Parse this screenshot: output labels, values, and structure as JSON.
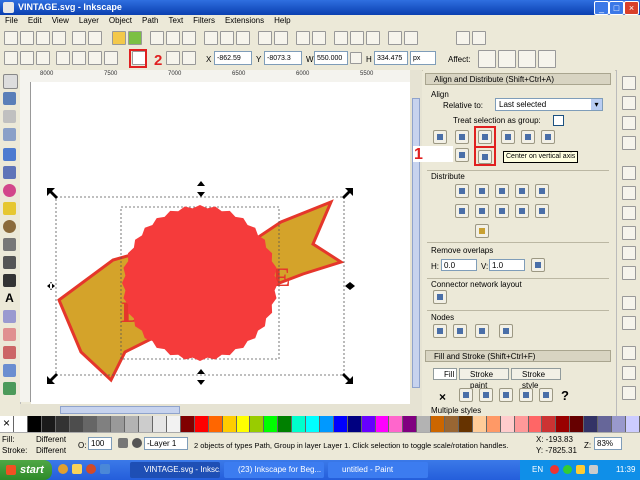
{
  "window": {
    "title": "VINTAGE.svg - Inkscape"
  },
  "menu": [
    "File",
    "Edit",
    "View",
    "Layer",
    "Object",
    "Path",
    "Text",
    "Filters",
    "Extensions",
    "Help"
  ],
  "controls": {
    "x_label": "X",
    "x_value": "-862.59",
    "y_label": "Y",
    "y_value": "-8073.3",
    "w_label": "W",
    "w_value": "550.000",
    "h_label": "H",
    "h_value": "334.475",
    "unit": "px",
    "affect_label": "Affect:"
  },
  "ruler": {
    "h_ticks": [
      "8000",
      "7500",
      "7000",
      "6500",
      "6000",
      "5500"
    ]
  },
  "annotations": {
    "one": "1",
    "two": "2"
  },
  "dock": {
    "align_title": "Align and Distribute (Shift+Ctrl+A)",
    "align_label": "Align",
    "relative_to_label": "Relative to:",
    "relative_to_value": "Last selected",
    "treat_group_label": "Treat selection as group:",
    "tooltip": "Center on vertical axis",
    "distribute_label": "Distribute",
    "remove_overlaps_label": "Remove overlaps",
    "h_label": "H:",
    "h_value": "0.0",
    "v_label": "V:",
    "v_value": "1.0",
    "connector_label": "Connector network layout",
    "nodes_label": "Nodes",
    "fill_title": "Fill and Stroke (Shift+Ctrl+F)",
    "fill_tab": "Fill",
    "stroke_paint_tab": "Stroke paint",
    "stroke_style_tab": "Stroke style",
    "multiple_styles": "Multiple styles",
    "x_glyph": "×",
    "q_glyph": "?"
  },
  "status": {
    "fill_label": "Fill:",
    "fill_value": "Different",
    "stroke_label": "Stroke:",
    "stroke_value": "Different",
    "opacity_label": "O:",
    "opacity_value": "100",
    "layer_value": "-Layer 1",
    "message": "2 objects of types Path, Group in layer Layer 1. Click selection to toggle scale/rotation handles.",
    "x_coord": "X: -193.83",
    "y_coord": "Y: -7825.31",
    "zoom_label": "Z:",
    "zoom_value": "83%"
  },
  "taskbar": {
    "start": "start",
    "tasks": [
      "VINTAGE.svg - Inksc...",
      "(23) Inkscape for Beg...",
      "untitled - Paint"
    ],
    "lang": "EN",
    "clock": "11:39"
  },
  "colors": {
    "badge_red": "#f53b3b",
    "ribbon_gold": "#d4a32a"
  }
}
